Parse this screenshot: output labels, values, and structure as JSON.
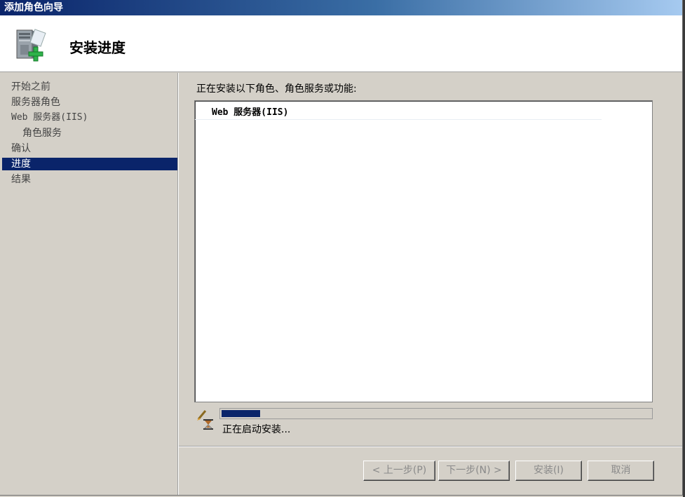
{
  "window": {
    "title": "添加角色向导"
  },
  "header": {
    "title": "安装进度",
    "icon": "server-add-icon"
  },
  "sidebar": {
    "items": [
      {
        "label": "开始之前",
        "active": false
      },
      {
        "label": "服务器角色",
        "active": false
      },
      {
        "label": "Web 服务器(IIS)",
        "active": false
      },
      {
        "label": "角色服务",
        "active": false
      },
      {
        "label": "确认",
        "active": false
      },
      {
        "label": "进度",
        "active": true
      },
      {
        "label": "结果",
        "active": false
      }
    ]
  },
  "main": {
    "description": "正在安装以下角色、角色服务或功能:",
    "install_items": [
      "Web 服务器(IIS)"
    ],
    "progress": {
      "fraction": 0.09,
      "status": "正在启动安装...",
      "icon": "hourglass-icon"
    }
  },
  "buttons": {
    "previous": "< 上一步(P)",
    "next": "下一步(N) >",
    "install": "安装(I)",
    "cancel": "取消"
  },
  "colors": {
    "selection": "#0a246a",
    "progress": "#0a246a"
  }
}
